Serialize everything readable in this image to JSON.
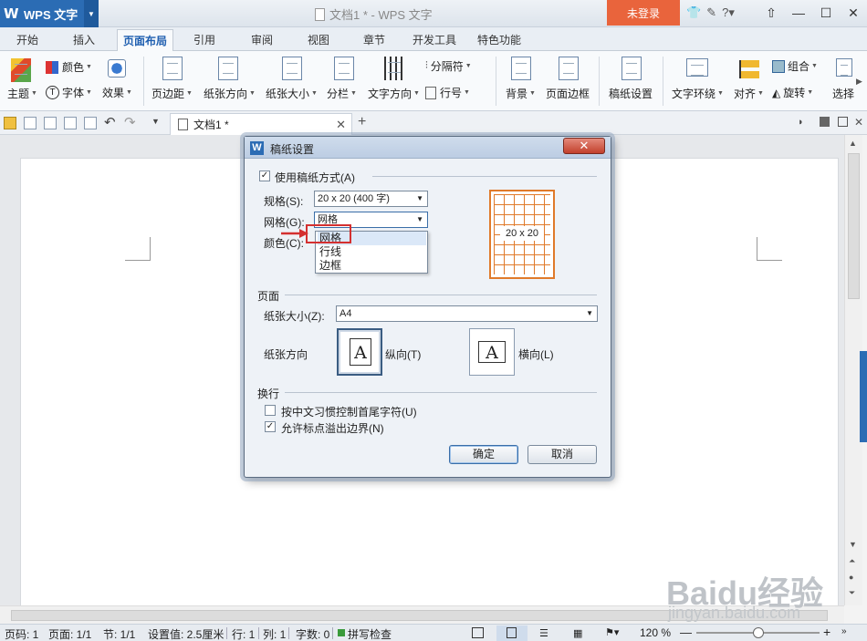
{
  "app": {
    "name": "WPS 文字",
    "logo": "W",
    "window_title": "文档1 * - WPS 文字",
    "login": "未登录"
  },
  "ribbon_tabs": [
    "开始",
    "插入",
    "页面布局",
    "引用",
    "审阅",
    "视图",
    "章节",
    "开发工具",
    "特色功能"
  ],
  "active_tab": "页面布局",
  "ribbon": {
    "theme": "主题",
    "color": "颜色",
    "font": "字体",
    "effect": "效果",
    "margin": "页边距",
    "orientation": "纸张方向",
    "paper_size": "纸张大小",
    "columns": "分栏",
    "text_direction": "文字方向",
    "break": "分隔符",
    "line_no": "行号",
    "background": "背景",
    "page_border": "页面边框",
    "grid_setup": "稿纸设置",
    "wrap": "文字环绕",
    "align": "对齐",
    "group": "组合",
    "rotate": "旋转",
    "select": "选择"
  },
  "doc_tab": {
    "name": "文档1 *"
  },
  "dialog": {
    "title": "稿纸设置",
    "use_grid_label": "使用稿纸方式(A)",
    "spec_label": "规格(S):",
    "spec_value": "20 x 20 (400 字)",
    "grid_label": "网格(G):",
    "grid_value": "网格",
    "color_label": "颜色(C):",
    "grid_options": [
      "网格",
      "行线",
      "边框"
    ],
    "preview_caption": "20 x 20",
    "page_section": "页面",
    "paper_size_label": "纸张大小(Z):",
    "paper_size_value": "A4",
    "orientation_label": "纸张方向",
    "portrait": "纵向(T)",
    "landscape": "横向(L)",
    "orient_glyph": "A",
    "wrap_section": "换行",
    "opt1": "按中文习惯控制首尾字符(U)",
    "opt2": "允许标点溢出边界(N)",
    "ok": "确定",
    "cancel": "取消"
  },
  "status": {
    "page_no": "页码: 1",
    "pages": "页面: 1/1",
    "section": "节: 1/1",
    "setting": "设置值: 2.5厘米",
    "row": "行: 1",
    "col": "列: 1",
    "words": "字数: 0",
    "spell": "拼写检查",
    "zoom": "120 %"
  },
  "watermark": {
    "main": "Baidu经验",
    "sub": "jingyan.baidu.com"
  }
}
